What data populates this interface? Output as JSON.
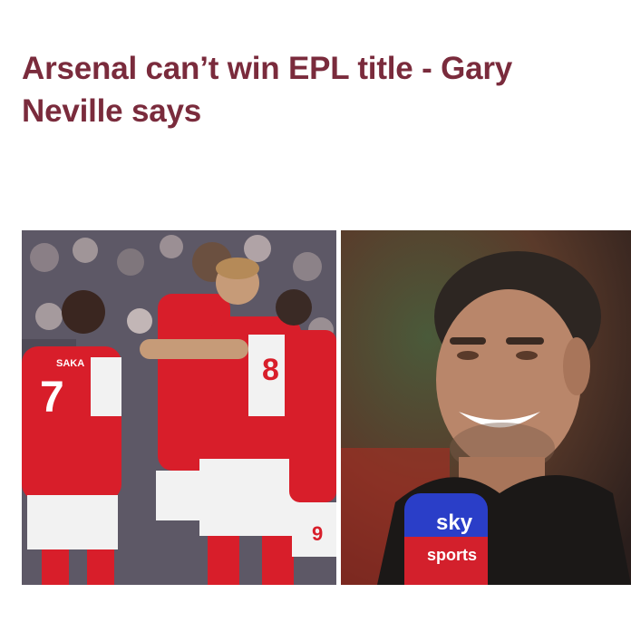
{
  "article": {
    "headline_line1": "Arsenal can’t win EPL title - Gary",
    "headline_line2": "Neville says"
  },
  "images": {
    "left": {
      "subject": "arsenal-players-celebrating",
      "shirt_name": "SAKA",
      "shirt_number": "7",
      "shirt_number_2": "8",
      "shirt_number_3": "9",
      "colors": {
        "shirt_red": "#d81e2a",
        "shirt_white": "#f2f2f2"
      }
    },
    "right": {
      "subject": "gary-neville-portrait",
      "mic_logo_top": "sky",
      "mic_logo_bottom": "sports",
      "colors": {
        "mic_blue": "#2a3ec8",
        "mic_red": "#d3202c"
      }
    }
  },
  "colors": {
    "headline": "#7a2b3c",
    "background": "#ffffff"
  }
}
